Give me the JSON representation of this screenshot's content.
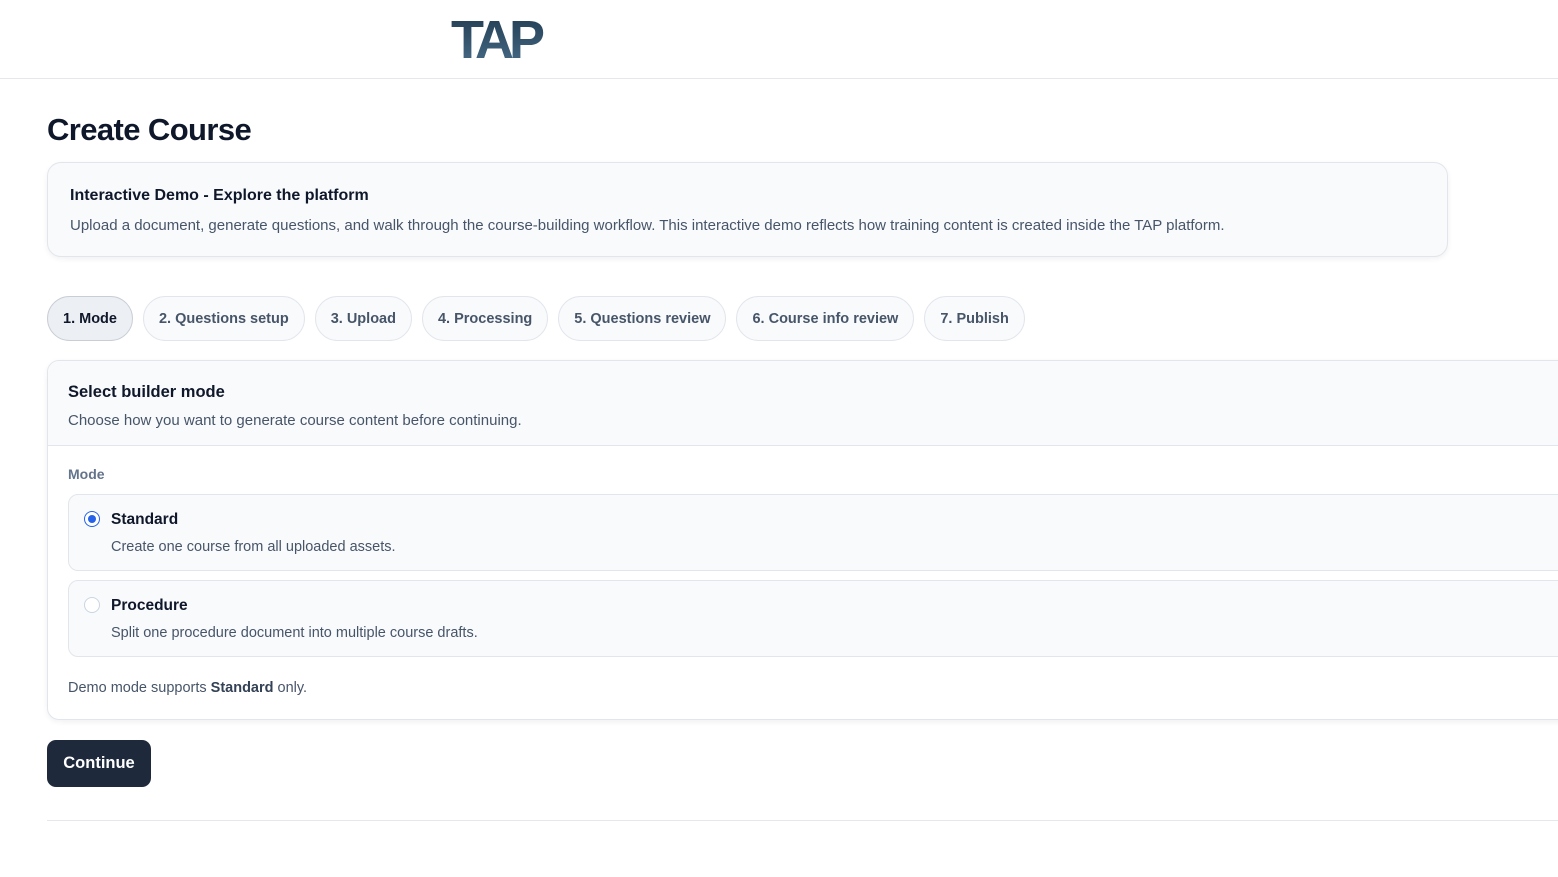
{
  "header": {
    "logo_text": "TAP"
  },
  "page": {
    "title": "Create Course"
  },
  "banner": {
    "title": "Interactive Demo - Explore the platform",
    "text": "Upload a document, generate questions, and walk through the course-building workflow. This interactive demo reflects how training content is created inside the TAP platform."
  },
  "steps": [
    {
      "label": "1. Mode",
      "active": true
    },
    {
      "label": "2. Questions setup",
      "active": false
    },
    {
      "label": "3. Upload",
      "active": false
    },
    {
      "label": "4. Processing",
      "active": false
    },
    {
      "label": "5. Questions review",
      "active": false
    },
    {
      "label": "6. Course info review",
      "active": false
    },
    {
      "label": "7. Publish",
      "active": false
    }
  ],
  "builder": {
    "title": "Select builder mode",
    "subtitle": "Choose how you want to generate course content before continuing.",
    "mode_label": "Mode",
    "options": [
      {
        "title": "Standard",
        "description": "Create one course from all uploaded assets.",
        "selected": true
      },
      {
        "title": "Procedure",
        "description": "Split one procedure document into multiple course drafts.",
        "selected": false
      }
    ],
    "note_prefix": "Demo mode supports ",
    "note_bold": "Standard",
    "note_suffix": " only."
  },
  "actions": {
    "continue_label": "Continue"
  },
  "colors": {
    "logo_dark": "#1f3a4f",
    "logo_light": "#4a6e8a",
    "primary_button": "#1e293b",
    "radio_accent": "#2563eb"
  }
}
